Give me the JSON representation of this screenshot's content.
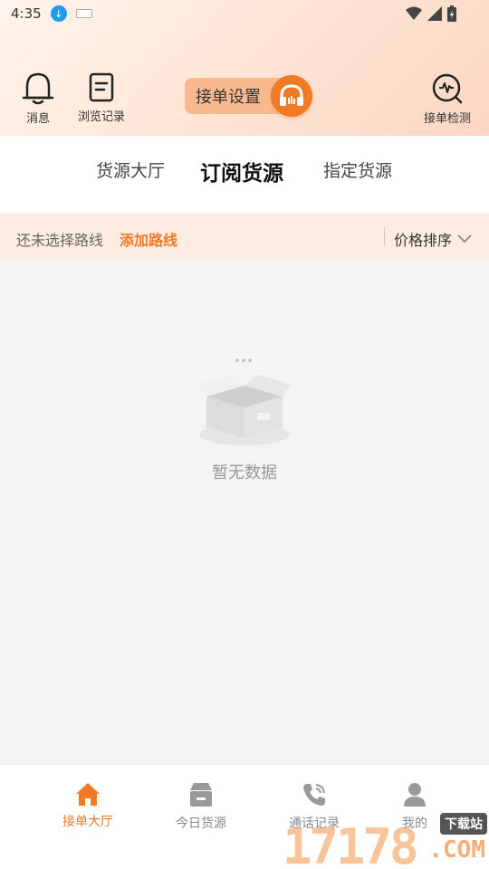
{
  "status_bar": {
    "time": "4:35"
  },
  "header": {
    "message_label": "消息",
    "history_label": "浏览记录",
    "order_settings_label": "接单设置",
    "order_check_label": "接单检测"
  },
  "tabs": [
    {
      "label": "货源大厅",
      "active": false
    },
    {
      "label": "订阅货源",
      "active": true
    },
    {
      "label": "指定货源",
      "active": false
    }
  ],
  "route_bar": {
    "no_route_text": "还未选择路线",
    "add_route_label": "添加路线",
    "sort_label": "价格排序"
  },
  "empty_state": {
    "text": "暂无数据"
  },
  "bottom_nav": [
    {
      "label": "接单大厅",
      "icon": "home-icon",
      "active": true
    },
    {
      "label": "今日货源",
      "icon": "box-icon",
      "active": false
    },
    {
      "label": "通话记录",
      "icon": "phone-icon",
      "active": false
    },
    {
      "label": "我的",
      "icon": "user-icon",
      "active": false
    }
  ],
  "watermark": {
    "number": "17178",
    "badge": "下载站",
    "domain": ".COM"
  },
  "colors": {
    "accent": "#f07a25",
    "header_bg": "#fde3d3",
    "route_bg": "#fcece2"
  }
}
